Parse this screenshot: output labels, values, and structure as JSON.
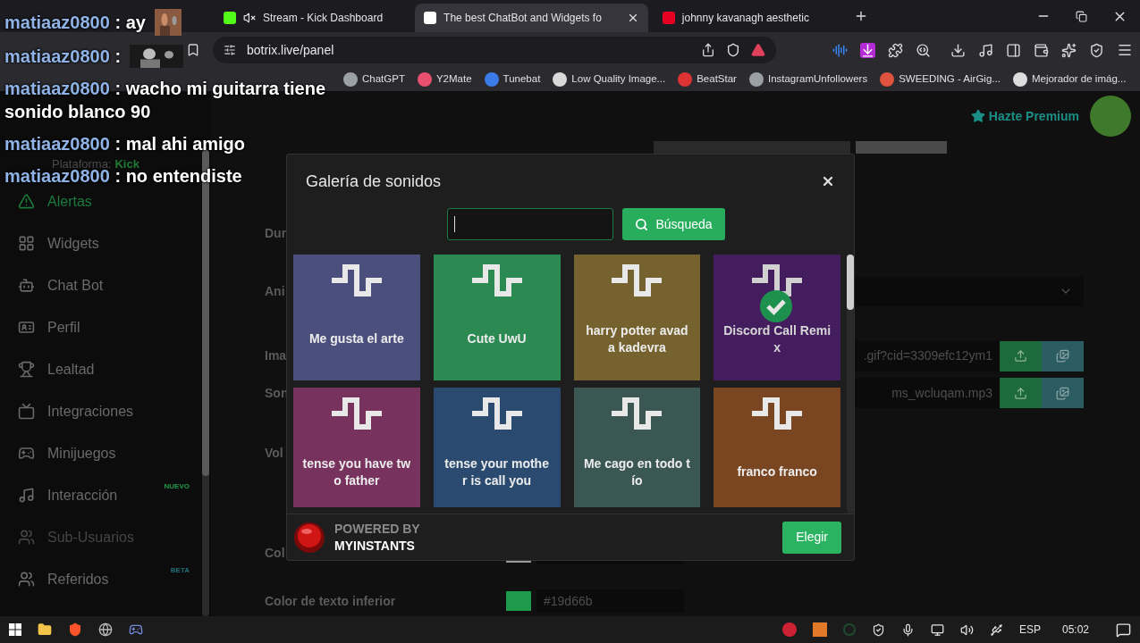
{
  "browser": {
    "tabs": [
      {
        "label": "Stream - Kick Dashboard",
        "selected": false,
        "muted": true
      },
      {
        "label": "The best ChatBot and Widgets fo",
        "selected": true,
        "muted": false
      },
      {
        "label": "johnny kavanagh aesthetic",
        "selected": false,
        "muted": false
      }
    ],
    "address": {
      "url": "botrix.live/panel"
    },
    "bookmarks": [
      {
        "label": "ChatGPT"
      },
      {
        "label": "Y2Mate"
      },
      {
        "label": "Tunebat"
      },
      {
        "label": "Low Quality Image..."
      },
      {
        "label": "BeatStar"
      },
      {
        "label": "InstagramUnfollowers"
      },
      {
        "label": "SWEEDING - AirGig..."
      },
      {
        "label": "Mejorador de imág..."
      }
    ]
  },
  "chat_overlay": {
    "messages": [
      {
        "user": "matiaaz0800",
        "text": ": ay",
        "image": true
      },
      {
        "user": "matiaaz0800",
        "text": ":",
        "image": true
      },
      {
        "user": "matiaaz0800",
        "text": ": wacho mi guitarra tiene sonido blanco 90",
        "image": false
      },
      {
        "user": "matiaaz0800",
        "text": ": mal ahi amigo",
        "image": false
      },
      {
        "user": "matiaaz0800",
        "text": ": no entendiste",
        "image": false
      }
    ]
  },
  "sidebar": {
    "platform_label": "Plataforma:",
    "platform": "Kick",
    "items": [
      {
        "label": "Alertas",
        "selected": true,
        "disabled": false
      },
      {
        "label": "Widgets",
        "selected": false,
        "disabled": false
      },
      {
        "label": "Chat Bot",
        "selected": false,
        "disabled": false
      },
      {
        "label": "Perfil",
        "selected": false,
        "disabled": false
      },
      {
        "label": "Lealtad",
        "selected": false,
        "disabled": false
      },
      {
        "label": "Integraciones",
        "selected": false,
        "disabled": false
      },
      {
        "label": "Minijuegos",
        "selected": false,
        "disabled": false
      },
      {
        "label": "Interacción",
        "selected": false,
        "disabled": false,
        "badge": {
          "text": "NUEVO",
          "color": "#1f9a4a"
        }
      },
      {
        "label": "Sub-Usuarios",
        "selected": false,
        "disabled": true
      },
      {
        "label": "Referidos",
        "selected": false,
        "disabled": false,
        "badge": {
          "text": "BETA",
          "color": "#1f6f7a"
        }
      }
    ]
  },
  "header": {
    "premium": "Hazte Premium"
  },
  "form": {
    "rows": [
      {
        "kind": "plain",
        "label": "Dur"
      },
      {
        "kind": "select",
        "label": "Ani"
      },
      {
        "kind": "file",
        "label": "Ima",
        "value": ".gif?cid=3309efc12ym1"
      },
      {
        "kind": "file",
        "label": "Son",
        "value": "ms_wcluqam.mp3"
      },
      {
        "kind": "plain",
        "label": "Vol"
      },
      {
        "kind": "color",
        "label": "Col",
        "color": "#9a9a9a"
      },
      {
        "kind": "color",
        "label": "Color de texto inferior",
        "color": "#1d9a4c",
        "value": "#19d66b"
      }
    ]
  },
  "modal": {
    "title": "Galería de sonidos",
    "search_button": "Búsqueda",
    "sounds": [
      {
        "label": "Me gusta el arte",
        "color": "#4b4f7e",
        "selected": false
      },
      {
        "label": "Cute UwU",
        "color": "#2b8a52",
        "selected": false
      },
      {
        "label": "harry potter avada kadevra",
        "color": "#75622e",
        "selected": false
      },
      {
        "label": "Discord Call Remix",
        "color": "#4a2068",
        "selected": true
      },
      {
        "label": "tense you have two father",
        "color": "#77335d",
        "selected": false
      },
      {
        "label": "tense your mother is call you",
        "color": "#2a4b6f",
        "selected": false
      },
      {
        "label": "Me cago en todo tío",
        "color": "#3a5753",
        "selected": false
      },
      {
        "label": "franco franco",
        "color": "#7a4622",
        "selected": false
      }
    ],
    "powered_by": "POWERED BY",
    "brand": "MYINSTANTS",
    "choose_button": "Elegir"
  },
  "taskbar": {
    "language": "ESP",
    "time": "05:02"
  }
}
